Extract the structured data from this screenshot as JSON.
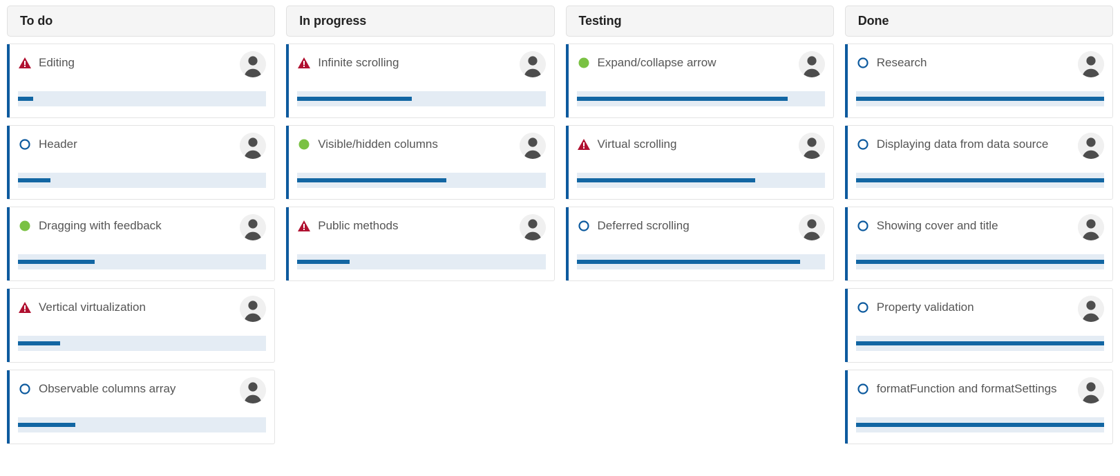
{
  "board": {
    "columns": [
      {
        "id": "todo",
        "title": "To do",
        "cards": [
          {
            "title": "Editing",
            "priority": "high",
            "priority_icon": "warning-triangle-icon",
            "progress": 6,
            "avatar_icon": "user-avatar-icon"
          },
          {
            "title": "Header",
            "priority": "normal",
            "priority_icon": "circle-outline-icon",
            "progress": 13,
            "avatar_icon": "user-avatar-icon"
          },
          {
            "title": "Dragging with feedback",
            "priority": "low",
            "priority_icon": "circle-filled-icon",
            "progress": 31,
            "avatar_icon": "user-avatar-icon"
          },
          {
            "title": "Vertical virtualization",
            "priority": "high",
            "priority_icon": "warning-triangle-icon",
            "progress": 17,
            "avatar_icon": "user-avatar-icon"
          },
          {
            "title": "Observable columns array",
            "priority": "normal",
            "priority_icon": "circle-outline-icon",
            "progress": 23,
            "avatar_icon": "user-avatar-icon"
          }
        ]
      },
      {
        "id": "in-progress",
        "title": "In progress",
        "cards": [
          {
            "title": "Infinite scrolling",
            "priority": "high",
            "priority_icon": "warning-triangle-icon",
            "progress": 46,
            "avatar_icon": "user-avatar-icon"
          },
          {
            "title": "Visible/hidden columns",
            "priority": "low",
            "priority_icon": "circle-filled-icon",
            "progress": 60,
            "avatar_icon": "user-avatar-icon"
          },
          {
            "title": "Public methods",
            "priority": "high",
            "priority_icon": "warning-triangle-icon",
            "progress": 21,
            "avatar_icon": "user-avatar-icon"
          }
        ]
      },
      {
        "id": "testing",
        "title": "Testing",
        "cards": [
          {
            "title": "Expand/collapse arrow",
            "priority": "low",
            "priority_icon": "circle-filled-icon",
            "progress": 85,
            "avatar_icon": "user-avatar-icon"
          },
          {
            "title": "Virtual scrolling",
            "priority": "high",
            "priority_icon": "warning-triangle-icon",
            "progress": 72,
            "avatar_icon": "user-avatar-icon"
          },
          {
            "title": "Deferred scrolling",
            "priority": "normal",
            "priority_icon": "circle-outline-icon",
            "progress": 90,
            "avatar_icon": "user-avatar-icon"
          }
        ]
      },
      {
        "id": "done",
        "title": "Done",
        "cards": [
          {
            "title": "Research",
            "priority": "normal",
            "priority_icon": "circle-outline-icon",
            "progress": 100,
            "avatar_icon": "user-avatar-icon"
          },
          {
            "title": "Displaying data from data source",
            "priority": "normal",
            "priority_icon": "circle-outline-icon",
            "progress": 100,
            "avatar_icon": "user-avatar-icon"
          },
          {
            "title": "Showing cover and title",
            "priority": "normal",
            "priority_icon": "circle-outline-icon",
            "progress": 100,
            "avatar_icon": "user-avatar-icon"
          },
          {
            "title": "Property validation",
            "priority": "normal",
            "priority_icon": "circle-outline-icon",
            "progress": 100,
            "avatar_icon": "user-avatar-icon"
          },
          {
            "title": "formatFunction and formatSettings",
            "priority": "normal",
            "priority_icon": "circle-outline-icon",
            "progress": 100,
            "avatar_icon": "user-avatar-icon"
          }
        ]
      }
    ]
  },
  "colors": {
    "accent_blue": "#0d5a9e",
    "progress_fill": "#1266a3",
    "progress_track": "#e4ecf4",
    "priority_high": "#b01030",
    "priority_low": "#7ac143",
    "priority_normal": "#0d5a9e",
    "header_background": "#f5f5f5",
    "card_border": "#e3e3e3",
    "title_text": "#555555",
    "avatar_background": "#f0f0f0",
    "avatar_figure": "#4d4d4d"
  }
}
